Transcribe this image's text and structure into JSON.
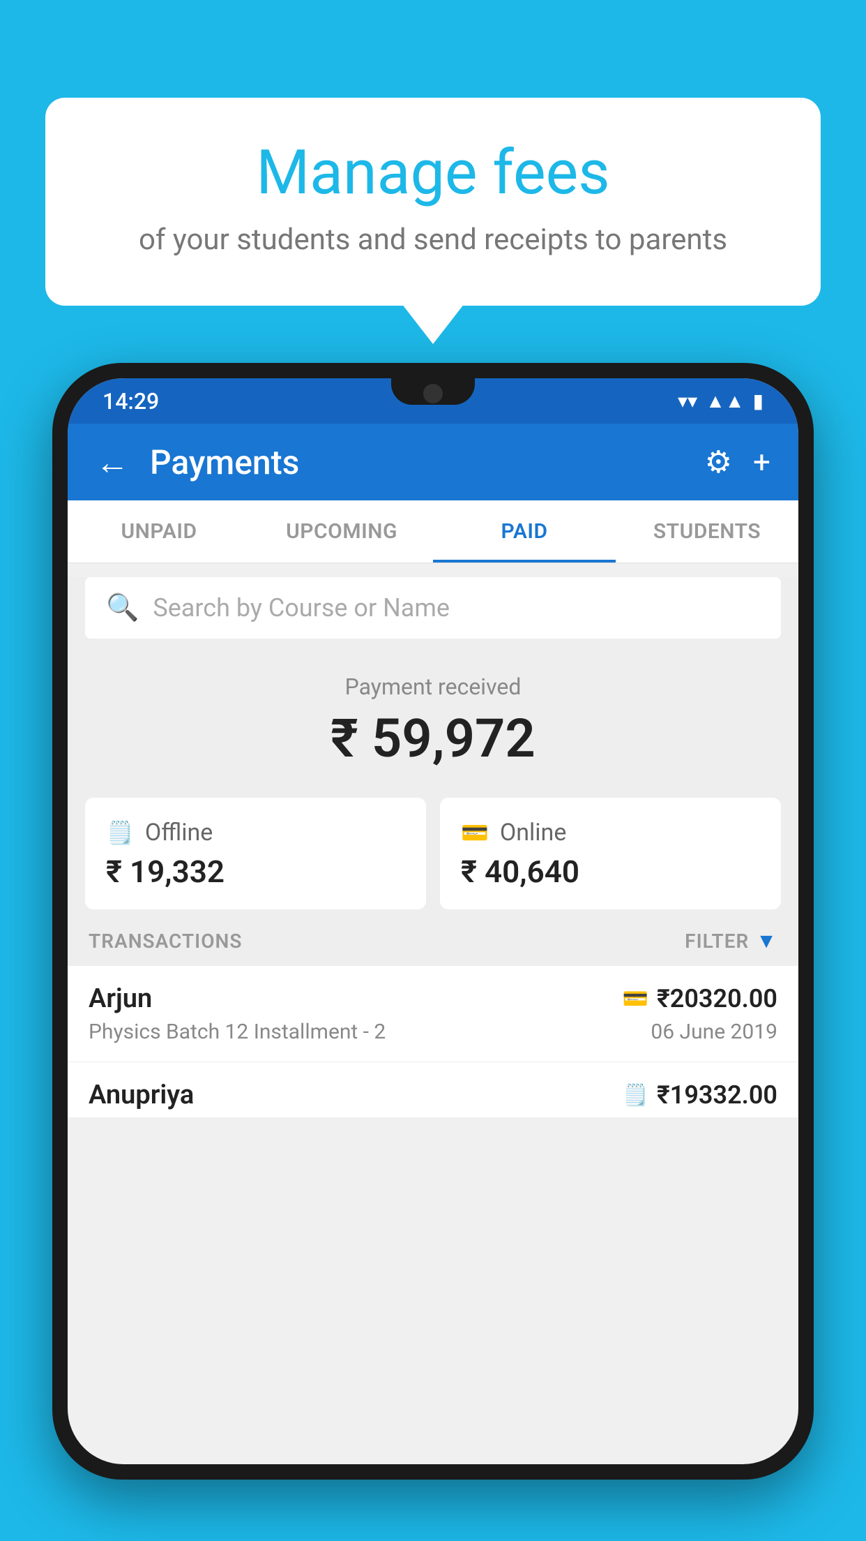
{
  "background_color": "#1db8e8",
  "speech_bubble": {
    "title": "Manage fees",
    "subtitle": "of your students and send receipts to parents"
  },
  "status_bar": {
    "time": "14:29",
    "wifi": "▼",
    "signal": "▲",
    "battery": "▮"
  },
  "top_bar": {
    "back_label": "←",
    "title": "Payments",
    "settings_icon": "⚙",
    "add_icon": "+"
  },
  "tabs": [
    {
      "label": "UNPAID",
      "active": false
    },
    {
      "label": "UPCOMING",
      "active": false
    },
    {
      "label": "PAID",
      "active": true
    },
    {
      "label": "STUDENTS",
      "active": false
    }
  ],
  "search": {
    "placeholder": "Search by Course or Name"
  },
  "payment_received": {
    "label": "Payment received",
    "amount": "₹ 59,972"
  },
  "payment_cards": [
    {
      "icon": "💳",
      "label": "Offline",
      "amount": "₹ 19,332"
    },
    {
      "icon": "💳",
      "label": "Online",
      "amount": "₹ 40,640"
    }
  ],
  "transactions_header": {
    "label": "TRANSACTIONS",
    "filter_label": "FILTER",
    "filter_icon": "▼"
  },
  "transactions": [
    {
      "name": "Arjun",
      "amount_icon": "💳",
      "amount": "₹20320.00",
      "course": "Physics Batch 12 Installment - 2",
      "date": "06 June 2019"
    },
    {
      "name": "Anupriya",
      "amount_icon": "💵",
      "amount": "₹19332.00",
      "course": "",
      "date": ""
    }
  ]
}
